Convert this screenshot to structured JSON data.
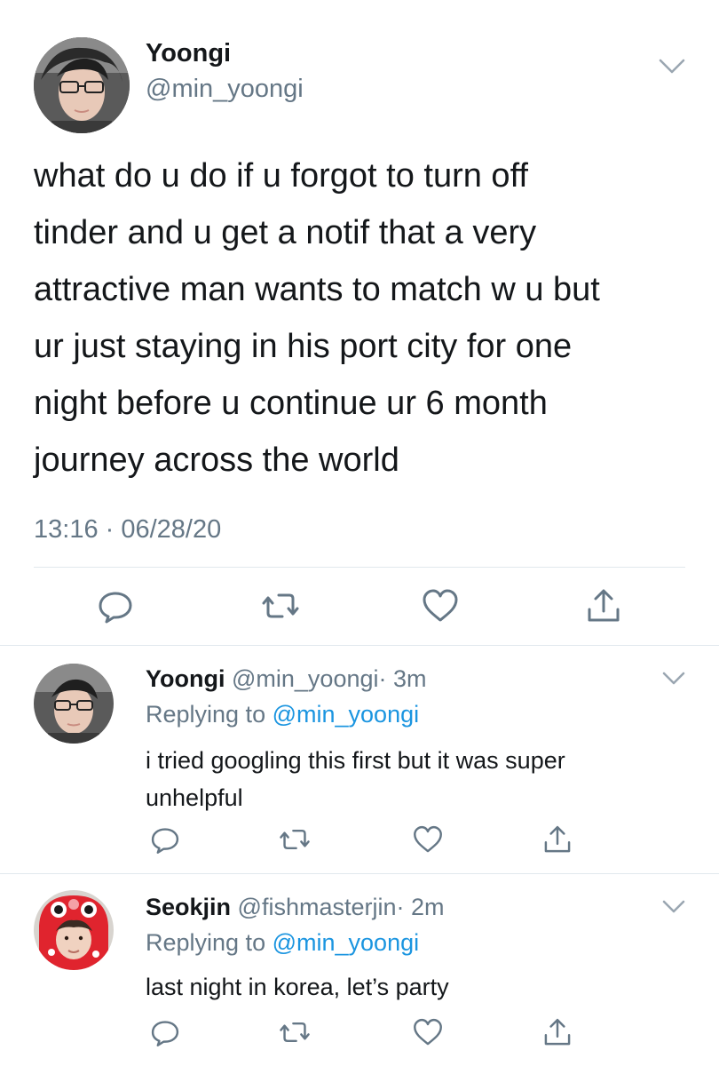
{
  "main_tweet": {
    "author_name": "Yoongi",
    "author_handle": "@min_yoongi",
    "avatar_icon": "avatar-photo",
    "text_lines": [
      "what do u do if u forgot to turn off",
      "tinder and u get a notif that a very",
      "attractive man wants to match w u but",
      "ur just staying in his port city for one",
      "night before u continue ur 6 month",
      "journey across the world"
    ],
    "timestamp": "13:16 · 06/28/20",
    "actions": [
      "reply-icon",
      "retweet-icon",
      "like-icon",
      "share-icon"
    ]
  },
  "replies": [
    {
      "author_name": "Yoongi",
      "author_handle": "@min_yoongi",
      "time": "· 3m",
      "replying_prefix": "Replying to",
      "replying_to": "@min_yoongi",
      "text_lines": [
        "i tried googling this first but it was super",
        "unhelpful"
      ]
    },
    {
      "author_name": "Seokjin",
      "author_handle": "@fishmasterjin",
      "time": "· 2m",
      "replying_prefix": "Replying to",
      "replying_to": "@min_yoongi",
      "text_lines": [
        "last night in korea, let’s party"
      ]
    }
  ],
  "colors": {
    "text": "#14171a",
    "secondary": "#657786",
    "link": "#1b95e0",
    "divider": "#e1e8ed"
  }
}
